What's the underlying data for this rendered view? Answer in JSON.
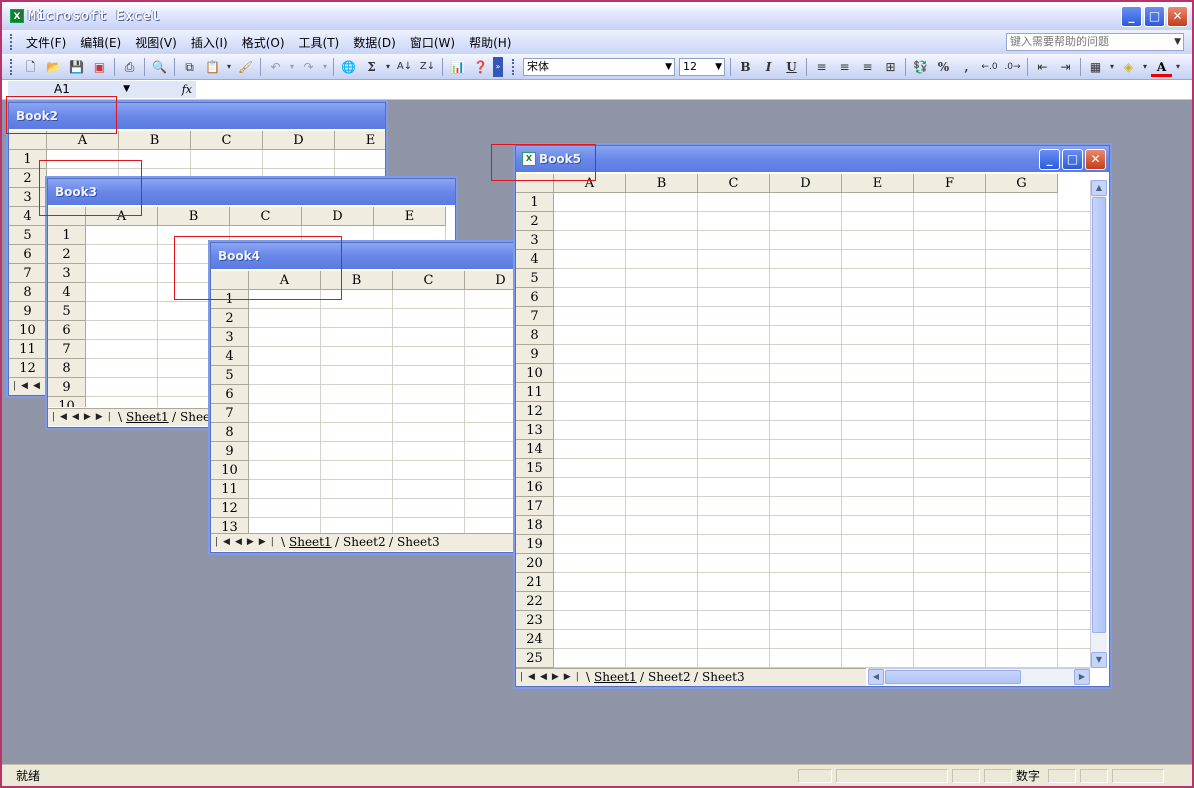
{
  "app": {
    "title": "Microsoft Excel",
    "icon": "excel-icon",
    "window_buttons": [
      "minimize",
      "maximize",
      "close"
    ]
  },
  "menu": {
    "items": [
      "文件(F)",
      "编辑(E)",
      "视图(V)",
      "插入(I)",
      "格式(O)",
      "工具(T)",
      "数据(D)",
      "窗口(W)",
      "帮助(H)"
    ],
    "help_placeholder": "键入需要帮助的问题"
  },
  "toolbar": {
    "font_name": "宋体",
    "font_size": "12",
    "bold": "B",
    "italic": "I",
    "underline": "U",
    "percent": "%",
    "comma": ",",
    "sum": "Σ"
  },
  "formula_bar": {
    "name_box": "A1",
    "fx": "fx"
  },
  "status": {
    "ready": "就绪",
    "num": "数字"
  },
  "workbooks": {
    "book2": {
      "title": "Book2",
      "columns": [
        "A",
        "B",
        "C",
        "D",
        "E"
      ],
      "rows": [
        "1",
        "2",
        "3",
        "4",
        "5",
        "6",
        "7",
        "8",
        "9",
        "10",
        "11",
        "12"
      ]
    },
    "book3": {
      "title": "Book3",
      "columns": [
        "A",
        "B",
        "C",
        "D",
        "E"
      ],
      "rows": [
        "1",
        "2",
        "3",
        "4",
        "5",
        "6",
        "7",
        "8",
        "9",
        "10"
      ],
      "tabs": [
        "Sheet1",
        "Shee"
      ]
    },
    "book4": {
      "title": "Book4",
      "columns": [
        "A",
        "B",
        "C",
        "D"
      ],
      "rows": [
        "1",
        "2",
        "3",
        "4",
        "5",
        "6",
        "7",
        "8",
        "9",
        "10",
        "11",
        "12",
        "13"
      ],
      "tabs": [
        "Sheet1",
        "Sheet2",
        "Sheet3"
      ]
    },
    "book5": {
      "title": "Book5",
      "columns": [
        "A",
        "B",
        "C",
        "D",
        "E",
        "F",
        "G"
      ],
      "rows": [
        "1",
        "2",
        "3",
        "4",
        "5",
        "6",
        "7",
        "8",
        "9",
        "10",
        "11",
        "12",
        "13",
        "14",
        "15",
        "16",
        "17",
        "18",
        "19",
        "20",
        "21",
        "22",
        "23",
        "24",
        "25"
      ],
      "tabs": [
        "Sheet1",
        "Sheet2",
        "Sheet3"
      ]
    }
  },
  "colors": {
    "highlight_box": "#e0141c",
    "workspace": "#8f95a7",
    "title_blue": "#6887e8"
  }
}
